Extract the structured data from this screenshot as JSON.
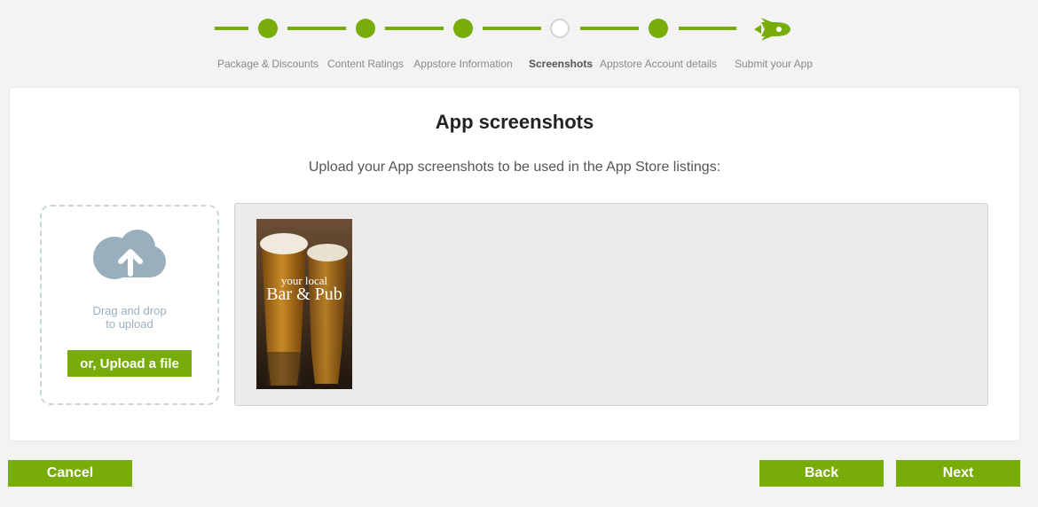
{
  "stepper": {
    "steps": [
      {
        "label": "Package & Discounts",
        "state": "done"
      },
      {
        "label": "Content Ratings",
        "state": "done"
      },
      {
        "label": "Appstore Information",
        "state": "done"
      },
      {
        "label": "Screenshots",
        "state": "current"
      },
      {
        "label": "Appstore Account details",
        "state": "done"
      },
      {
        "label": "Submit your App",
        "state": "final",
        "icon": "rocket-icon"
      }
    ]
  },
  "card": {
    "title": "App screenshots",
    "subtitle": "Upload your App screenshots to be used in the App Store listings:"
  },
  "dropzone": {
    "icon": "cloud-upload-icon",
    "text_line1": "Drag and drop",
    "text_line2": "to upload",
    "button_label": "or, Upload a file"
  },
  "gallery": {
    "screenshots": [
      {
        "line1": "your local",
        "line2": "Bar & Pub"
      }
    ]
  },
  "footer": {
    "cancel_label": "Cancel",
    "back_label": "Back",
    "next_label": "Next"
  },
  "colors": {
    "accent": "#78ad09",
    "background": "#f3f3f3",
    "dropzone_border": "#c8d6dd",
    "cloud": "#9aafbd"
  }
}
